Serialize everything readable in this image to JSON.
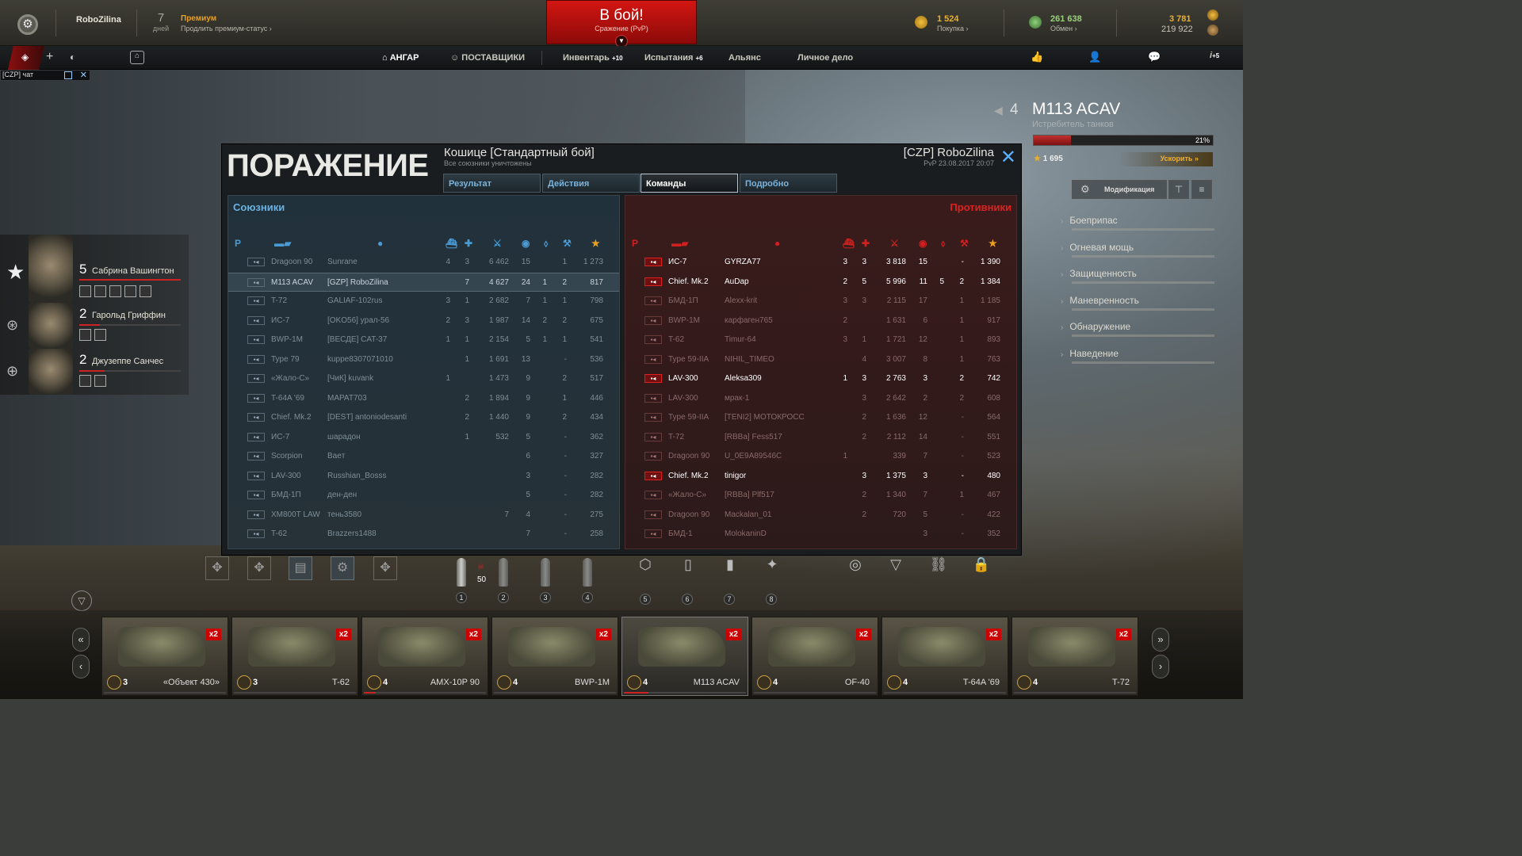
{
  "topbar": {
    "username": "RoboZilina",
    "days": "7",
    "days_label": "дней",
    "premium": "Премиум",
    "premium_sub": "Продлить премиум-статус",
    "battle": "В бой!",
    "battle_sub": "Сражение (PvP)",
    "gold": "1 524",
    "gold_label": "Покупка",
    "credits": "261 638",
    "credits_label": "Обмен",
    "xp1": "3 781",
    "xp2": "219 922"
  },
  "nav": {
    "hangar": "АНГАР",
    "suppliers": "ПОСТАВЩИКИ",
    "inventory": "Инвентарь",
    "inventory_badge": "+10",
    "trials": "Испытания",
    "trials_badge": "+6",
    "alliance": "Альянс",
    "personal": "Личное дело",
    "right_badge": "+5"
  },
  "chat": {
    "label": "[CZP] чат"
  },
  "crew": [
    {
      "level": "5",
      "name": "Сабрина Вашингтон"
    },
    {
      "level": "2",
      "name": "Гарольд Гриффин"
    },
    {
      "level": "2",
      "name": "Джузеппе Санчес"
    }
  ],
  "vehicle": {
    "tier": "4",
    "name": "M113 ACAV",
    "type": "Истребитель танков",
    "progress": "21%",
    "progress_value": 21,
    "xp": "1 695",
    "accelerate": "Ускорить",
    "modification": "Модификация",
    "specs": [
      "Боеприпас",
      "Огневая мощь",
      "Защищенность",
      "Маневренность",
      "Обнаружение",
      "Наведение"
    ]
  },
  "result": {
    "title": "ПОРАЖЕНИЕ",
    "map": "Кошице [Стандартный бой]",
    "map_sub": "Все союзники уничтожены",
    "player": "[CZP] RoboZilina",
    "date": "PvP 23.08.2017 20:07",
    "tabs": [
      "Результат",
      "Действия",
      "Команды",
      "Подробно"
    ],
    "allies_label": "Союзники",
    "enemies_label": "Противники",
    "allies": [
      [
        "Dragoon 90",
        "Sunrane",
        "4",
        "3",
        "6 462",
        "15",
        "",
        "1",
        "1 273"
      ],
      [
        "M113 ACAV",
        "[GZP] RoboZilina",
        "",
        "7",
        "4 627",
        "24",
        "1",
        "2",
        "817"
      ],
      [
        "T-72",
        "GALIAF-102rus",
        "3",
        "1",
        "2 682",
        "7",
        "1",
        "1",
        "798"
      ],
      [
        "ИС-7",
        "[OKO56] yрал-56",
        "2",
        "3",
        "1 987",
        "14",
        "2",
        "2",
        "675"
      ],
      [
        "BWP-1M",
        "[ВЕСДЕ] CAT-37",
        "1",
        "1",
        "2 154",
        "5",
        "1",
        "1",
        "541"
      ],
      [
        "Type 79",
        "kuppe8307071010",
        "",
        "1",
        "1 691",
        "13",
        "",
        "-",
        "536"
      ],
      [
        "«Жало-С»",
        "[ЧиК] kuvank",
        "1",
        "",
        "1 473",
        "9",
        "",
        "2",
        "517"
      ],
      [
        "T-64A '69",
        "MAPAT703",
        "",
        "2",
        "1 894",
        "9",
        "",
        "1",
        "446"
      ],
      [
        "Chief. Mk.2",
        "[DEST] antoniodesanti",
        "",
        "2",
        "1 440",
        "9",
        "",
        "2",
        "434"
      ],
      [
        "ИС-7",
        "шарадон",
        "",
        "1",
        "532",
        "5",
        "",
        "-",
        "362"
      ],
      [
        "Scorpion",
        "Ваeт",
        "",
        "",
        "",
        "6",
        "",
        "-",
        "327"
      ],
      [
        "LAV-300",
        "Russhian_Bosss",
        "",
        "",
        "",
        "3",
        "",
        "-",
        "282"
      ],
      [
        "БМД-1П",
        "ден-ден",
        "",
        "",
        "",
        "5",
        "",
        "-",
        "282"
      ],
      [
        "XM800T LAW",
        "тень3580",
        "",
        "",
        "7",
        "4",
        "",
        "-",
        "275"
      ],
      [
        "T-62",
        "Brazzers1488",
        "",
        "",
        "",
        "7",
        "",
        "-",
        "258"
      ]
    ],
    "enemies": [
      [
        "ИС-7",
        "GYRZA77",
        "3",
        "3",
        "3 818",
        "15",
        "",
        "-",
        "1 390"
      ],
      [
        "Chief. Mk.2",
        "AuDap",
        "2",
        "5",
        "5 996",
        "11",
        "5",
        "2",
        "1 384"
      ],
      [
        "БМД-1П",
        "Alexx-krit",
        "3",
        "3",
        "2 115",
        "17",
        "",
        "1",
        "1 185"
      ],
      [
        "BWP-1M",
        "карфаген765",
        "2",
        "",
        "1 631",
        "6",
        "",
        "1",
        "917"
      ],
      [
        "T-62",
        "Timur-64",
        "3",
        "1",
        "1 721",
        "12",
        "",
        "1",
        "893"
      ],
      [
        "Type 59-IIA",
        "NIHIL_TIMEO",
        "",
        "4",
        "3 007",
        "8",
        "",
        "1",
        "763"
      ],
      [
        "LAV-300",
        "Aleksa309",
        "1",
        "3",
        "2 763",
        "3",
        "",
        "2",
        "742"
      ],
      [
        "LAV-300",
        "мрак-1",
        "",
        "3",
        "2 642",
        "2",
        "",
        "2",
        "608"
      ],
      [
        "Type 59-IIA",
        "[TENI2] МОТОКРОСС",
        "",
        "2",
        "1 636",
        "12",
        "",
        "-",
        "564"
      ],
      [
        "T-72",
        "[RBBa] Fess517",
        "",
        "2",
        "2 112",
        "14",
        "",
        "-",
        "551"
      ],
      [
        "Dragoon 90",
        "U_0E9A89546C",
        "1",
        "",
        "339",
        "7",
        "",
        "-",
        "523"
      ],
      [
        "Chief. Mk.2",
        "tinigor",
        "",
        "3",
        "1 375",
        "3",
        "",
        "-",
        "480"
      ],
      [
        "«Жало-С»",
        "[RBBa] Plf517",
        "",
        "2",
        "1 340",
        "7",
        "",
        "1",
        "467"
      ],
      [
        "Dragoon 90",
        "Mackalan_01",
        "",
        "2",
        "720",
        "5",
        "",
        "-",
        "422"
      ],
      [
        "БМД-1",
        "MolokaninD",
        "",
        "",
        "",
        "3",
        "",
        "-",
        "352"
      ]
    ]
  },
  "ammo": {
    "count": "50",
    "slots": [
      "1",
      "2",
      "3",
      "4",
      "5",
      "6",
      "7",
      "8"
    ]
  },
  "carousel": [
    {
      "tier": "3",
      "name": "«Объект 430»",
      "badge": "x2"
    },
    {
      "tier": "3",
      "name": "T-62",
      "badge": "x2"
    },
    {
      "tier": "4",
      "name": "AMX-10P 90",
      "badge": "x2"
    },
    {
      "tier": "4",
      "name": "BWP-1M",
      "badge": "x2"
    },
    {
      "tier": "4",
      "name": "M113 ACAV",
      "badge": "x2"
    },
    {
      "tier": "4",
      "name": "OF-40",
      "badge": "x2"
    },
    {
      "tier": "4",
      "name": "T-64A '69",
      "badge": "x2"
    },
    {
      "tier": "4",
      "name": "T-72",
      "badge": "x2"
    }
  ]
}
